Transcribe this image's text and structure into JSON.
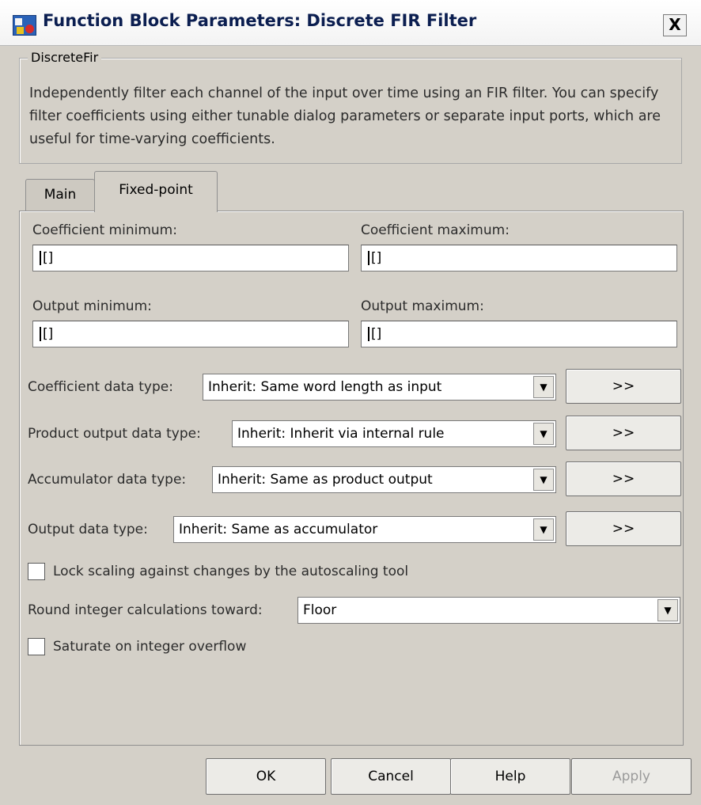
{
  "window": {
    "title": "Function Block Parameters: Discrete FIR Filter",
    "close_label": "X"
  },
  "description": {
    "group_label": "DiscreteFir",
    "text": "Independently filter each channel of the input over time using an FIR filter. You can specify filter coefficients using either tunable dialog parameters or separate input ports, which are useful for time-varying coefficients."
  },
  "tabs": [
    {
      "label": "Main",
      "active": false
    },
    {
      "label": "Fixed-point",
      "active": true
    }
  ],
  "fields": {
    "coef_min": {
      "label": "Coefficient minimum:",
      "value": "[]"
    },
    "coef_max": {
      "label": "Coefficient maximum:",
      "value": "[]"
    },
    "out_min": {
      "label": "Output minimum:",
      "value": "[]"
    },
    "out_max": {
      "label": "Output maximum:",
      "value": "[]"
    }
  },
  "datatypes": {
    "coefficient": {
      "label": "Coefficient data type:",
      "value": "Inherit: Same word length as input",
      "button": ">>"
    },
    "product": {
      "label": "Product output data type:",
      "value": "Inherit: Inherit via internal rule",
      "button": ">>"
    },
    "accumulator": {
      "label": "Accumulator data type:",
      "value": "Inherit: Same as product output",
      "button": ">>"
    },
    "output": {
      "label": "Output data type:",
      "value": "Inherit: Same as accumulator",
      "button": ">>"
    }
  },
  "options": {
    "lock_scaling": {
      "label": "Lock scaling against changes by the autoscaling tool",
      "checked": false
    },
    "round_label": "Round integer calculations toward:",
    "round_value": "Floor",
    "saturate": {
      "label": "Saturate on integer overflow",
      "checked": false
    }
  },
  "buttons": {
    "ok": "OK",
    "cancel": "Cancel",
    "help": "Help",
    "apply": "Apply"
  },
  "icons": {
    "dropdown_arrow": "▼"
  }
}
